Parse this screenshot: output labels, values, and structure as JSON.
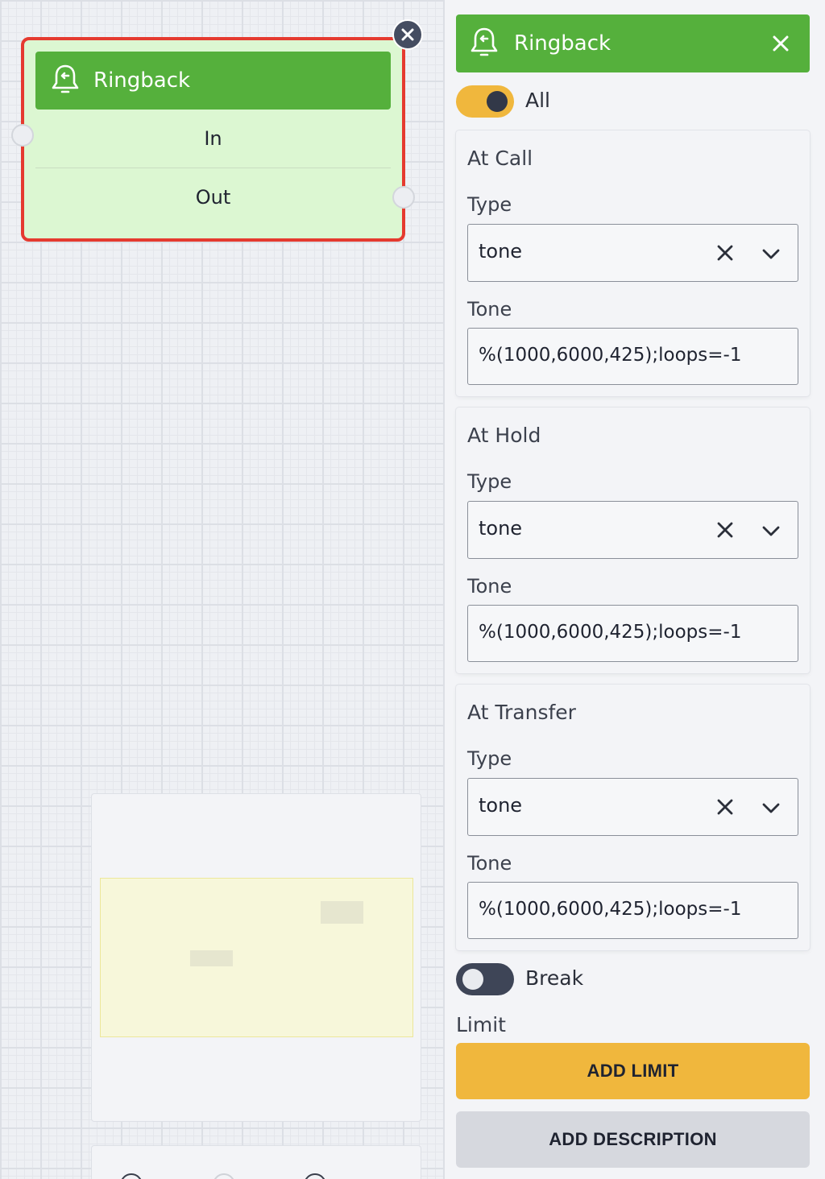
{
  "node": {
    "title": "Ringback",
    "in_label": "In",
    "out_label": "Out",
    "icon": "bell-icon",
    "border_color": "#e53a2f",
    "header_color": "#55b03c",
    "body_color": "#dcf7d2"
  },
  "panel": {
    "title": "Ringback",
    "icon": "bell-icon",
    "all_toggle": {
      "label": "All",
      "on": true
    },
    "sections": [
      {
        "title": "At Call",
        "type_label": "Type",
        "type_value": "tone",
        "tone_label": "Tone",
        "tone_value": "%(1000,6000,425);loops=-1"
      },
      {
        "title": "At Hold",
        "type_label": "Type",
        "type_value": "tone",
        "tone_label": "Tone",
        "tone_value": "%(1000,6000,425);loops=-1"
      },
      {
        "title": "At Transfer",
        "type_label": "Type",
        "type_value": "tone",
        "tone_label": "Tone",
        "tone_value": "%(1000,6000,425);loops=-1"
      }
    ],
    "break_toggle": {
      "label": "Break",
      "on": false
    },
    "limit_label": "Limit",
    "add_limit_label": "ADD LIMIT",
    "add_description_label": "ADD DESCRIPTION"
  },
  "colors": {
    "accent_green": "#55b03c",
    "accent_yellow": "#f0b73d",
    "danger_red": "#e53a2f"
  }
}
